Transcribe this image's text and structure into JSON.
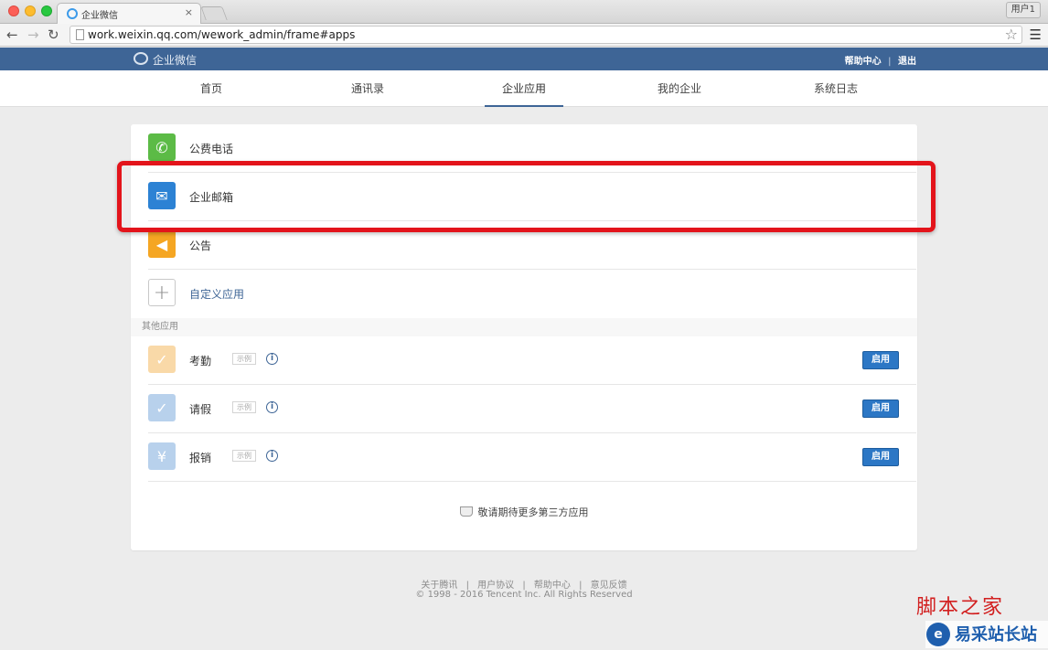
{
  "browser": {
    "tab_title": "企业微信",
    "tab_close": "×",
    "user_button": "用户1",
    "url": "work.weixin.qq.com/wework_admin/frame#apps",
    "back_icon": "←",
    "forward_icon": "→",
    "reload_icon": "↻",
    "star_icon": "☆",
    "menu_icon": "☰"
  },
  "header": {
    "logo_text": "企业微信",
    "help_label": "帮助中心",
    "separator": "|",
    "logout_label": "退出"
  },
  "nav": {
    "items": [
      {
        "label": "首页"
      },
      {
        "label": "通讯录"
      },
      {
        "label": "企业应用",
        "active": true
      },
      {
        "label": "我的企业"
      },
      {
        "label": "系统日志"
      }
    ]
  },
  "apps": {
    "builtin": [
      {
        "name": "公费电话",
        "icon": "phone-icon",
        "glyph": "✆"
      },
      {
        "name": "企业邮箱",
        "icon": "mail-icon",
        "glyph": "✉"
      },
      {
        "name": "公告",
        "icon": "megaphone-icon",
        "glyph": "◀"
      }
    ],
    "custom": {
      "name": "自定义应用",
      "icon": "plus-icon",
      "glyph": "+"
    },
    "other_label": "其他应用",
    "other": [
      {
        "name": "考勤",
        "tag": "示例",
        "info": "i",
        "button": "启用",
        "icon": "location-check-icon",
        "glyph": "✓"
      },
      {
        "name": "请假",
        "tag": "示例",
        "info": "i",
        "button": "启用",
        "icon": "calendar-check-icon",
        "glyph": "✓"
      },
      {
        "name": "报销",
        "tag": "示例",
        "info": "i",
        "button": "启用",
        "icon": "yen-receipt-icon",
        "glyph": "¥"
      }
    ],
    "more_text": "敬请期待更多第三方应用"
  },
  "footer": {
    "links": [
      "关于腾讯",
      "用户协议",
      "帮助中心",
      "意见反馈"
    ],
    "separator": "|",
    "copyright": "© 1998 - 2016 Tencent Inc. All Rights Reserved"
  },
  "watermark": {
    "top": "脚本之家",
    "bottom": "易采站长站",
    "logo_glyph": "e"
  },
  "colors": {
    "header_bg": "#3e6596",
    "highlight": "#e3141b",
    "enable_button": "#2c77c5"
  }
}
